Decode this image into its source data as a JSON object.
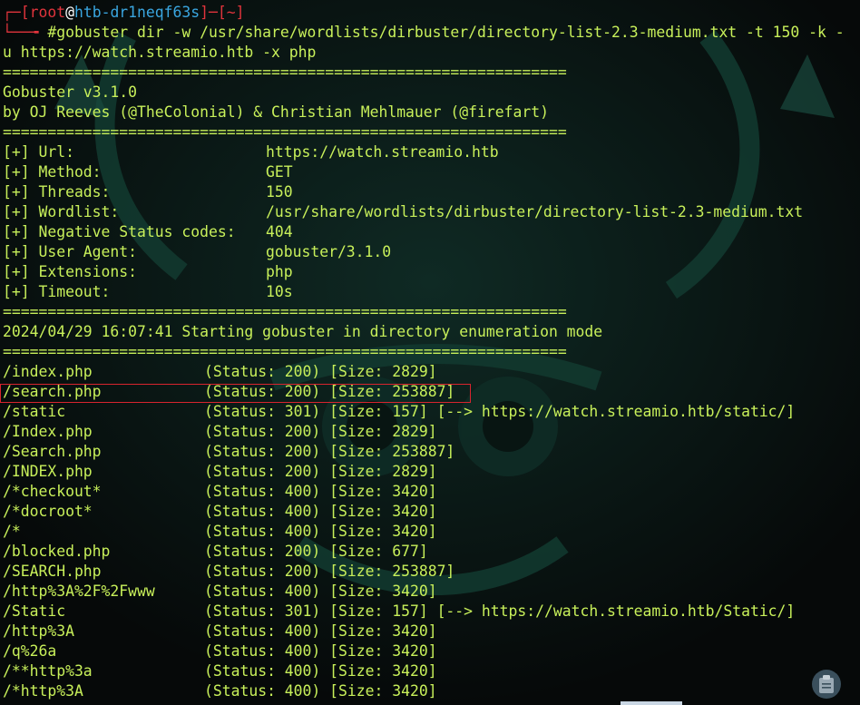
{
  "prompt": {
    "user": "root",
    "at": "@",
    "host": "htb-dr1neqf63s",
    "dir": "~",
    "command_line1": "#gobuster dir -w /usr/share/wordlists/dirbuster/directory-list-2.3-medium.txt -t 150 -k -",
    "command_line2": "u https://watch.streamio.htb -x php"
  },
  "separator": "===============================================================",
  "banner": {
    "title": "Gobuster v3.1.0",
    "authors": "by OJ Reeves (@TheColonial) & Christian Mehlmauer (@firefart)"
  },
  "config": [
    {
      "label": "[+] Url:",
      "value": "https://watch.streamio.htb"
    },
    {
      "label": "[+] Method:",
      "value": "GET"
    },
    {
      "label": "[+] Threads:",
      "value": "150"
    },
    {
      "label": "[+] Wordlist:",
      "value": "/usr/share/wordlists/dirbuster/directory-list-2.3-medium.txt"
    },
    {
      "label": "[+] Negative Status codes:",
      "value": "404"
    },
    {
      "label": "[+] User Agent:",
      "value": "gobuster/3.1.0"
    },
    {
      "label": "[+] Extensions:",
      "value": "php"
    },
    {
      "label": "[+] Timeout:",
      "value": "10s"
    }
  ],
  "start_message": "2024/04/29 16:07:41 Starting gobuster in directory enumeration mode",
  "results": [
    {
      "path": "/index.php",
      "info": "(Status: 200) [Size: 2829]"
    },
    {
      "path": "/search.php",
      "info": "(Status: 200) [Size: 253887]"
    },
    {
      "path": "/static",
      "info": "(Status: 301) [Size: 157] [--> https://watch.streamio.htb/static/]"
    },
    {
      "path": "/Index.php",
      "info": "(Status: 200) [Size: 2829]"
    },
    {
      "path": "/Search.php",
      "info": "(Status: 200) [Size: 253887]"
    },
    {
      "path": "/INDEX.php",
      "info": "(Status: 200) [Size: 2829]"
    },
    {
      "path": "/*checkout*",
      "info": "(Status: 400) [Size: 3420]"
    },
    {
      "path": "/*docroot*",
      "info": "(Status: 400) [Size: 3420]"
    },
    {
      "path": "/*",
      "info": "(Status: 400) [Size: 3420]"
    },
    {
      "path": "/blocked.php",
      "info": "(Status: 200) [Size: 677]"
    },
    {
      "path": "/SEARCH.php",
      "info": "(Status: 200) [Size: 253887]"
    },
    {
      "path": "/http%3A%2F%2Fwww",
      "info": "(Status: 400) [Size: 3420]"
    },
    {
      "path": "/Static",
      "info": "(Status: 301) [Size: 157] [--> https://watch.streamio.htb/Static/]"
    },
    {
      "path": "/http%3A",
      "info": "(Status: 400) [Size: 3420]"
    },
    {
      "path": "/q%26a",
      "info": "(Status: 400) [Size: 3420]"
    },
    {
      "path": "/**http%3a",
      "info": "(Status: 400) [Size: 3420]"
    },
    {
      "path": "/*http%3A",
      "info": "(Status: 400) [Size: 3420]"
    }
  ],
  "colors": {
    "text": "#c8f05a",
    "prompt": "#e0343c",
    "host": "#3aa6e0",
    "highlight_border": "#d8242e",
    "background": "#070a0b"
  },
  "icons": {
    "clipboard": "clipboard-icon"
  }
}
